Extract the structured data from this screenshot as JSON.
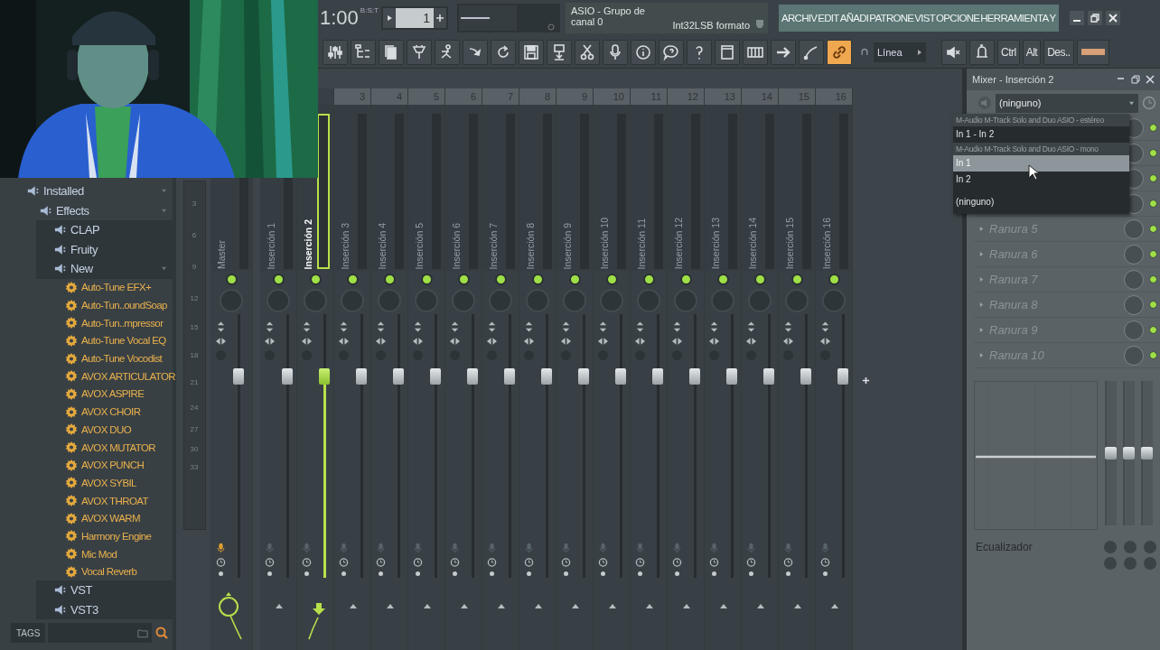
{
  "transport": {
    "time": "1:00",
    "time_unit": "B:S:T",
    "pattern": "1"
  },
  "hint": {
    "line_1": "ASIO - Grupo de",
    "line_2": "canal 0",
    "format": "Int32LSB formato"
  },
  "menu": [
    "ARCHIV",
    "EDIT",
    "AÑADI",
    "PATRONE",
    "VIST",
    "OPCIONE",
    "HERRAMIENTA",
    "Y"
  ],
  "toolbar": {
    "link_on": true,
    "snap": "Línea",
    "keys": [
      "Ctrl",
      "Alt",
      "Des.."
    ]
  },
  "browser": {
    "tree": [
      {
        "label": "Installed",
        "kind": "folder",
        "expanded": true,
        "children": [
          {
            "label": "Effects",
            "kind": "folder",
            "expanded": true,
            "children": [
              {
                "label": "CLAP",
                "kind": "folder",
                "expanded": false
              },
              {
                "label": "Fruity",
                "kind": "folder",
                "expanded": false
              },
              {
                "label": "New",
                "kind": "folder",
                "expanded": true,
                "children": [
                  {
                    "label": "Auto-Tune EFX+",
                    "kind": "plugin"
                  },
                  {
                    "label": "Auto-Tun..oundSoap",
                    "kind": "plugin"
                  },
                  {
                    "label": "Auto-Tun..mpressor",
                    "kind": "plugin"
                  },
                  {
                    "label": "Auto-Tune Vocal EQ",
                    "kind": "plugin"
                  },
                  {
                    "label": "Auto-Tune Vocodist",
                    "kind": "plugin"
                  },
                  {
                    "label": "AVOX ARTICULATOR",
                    "kind": "plugin"
                  },
                  {
                    "label": "AVOX ASPIRE",
                    "kind": "plugin"
                  },
                  {
                    "label": "AVOX CHOIR",
                    "kind": "plugin"
                  },
                  {
                    "label": "AVOX DUO",
                    "kind": "plugin"
                  },
                  {
                    "label": "AVOX MUTATOR",
                    "kind": "plugin"
                  },
                  {
                    "label": "AVOX PUNCH",
                    "kind": "plugin"
                  },
                  {
                    "label": "AVOX SYBIL",
                    "kind": "plugin"
                  },
                  {
                    "label": "AVOX THROAT",
                    "kind": "plugin"
                  },
                  {
                    "label": "AVOX WARM",
                    "kind": "plugin"
                  },
                  {
                    "label": "Harmony Engine",
                    "kind": "plugin"
                  },
                  {
                    "label": "Mic Mod",
                    "kind": "plugin"
                  },
                  {
                    "label": "Vocal Reverb",
                    "kind": "plugin"
                  }
                ]
              },
              {
                "label": "VST",
                "kind": "folder",
                "expanded": false
              },
              {
                "label": "VST3",
                "kind": "folder",
                "expanded": false
              }
            ]
          }
        ]
      }
    ],
    "tags_button": "TAGS"
  },
  "mixer": {
    "scale": [
      "3",
      "6",
      "9",
      "12",
      "15",
      "18",
      "21",
      "24",
      "27",
      "30",
      "33"
    ],
    "tracks": [
      {
        "name": "Master",
        "kind": "master",
        "selected": false,
        "on": true,
        "armed": true,
        "routed": true,
        "level": 0.78
      },
      {
        "name": "Inserción 1",
        "kind": "insert",
        "selected": false,
        "on": true,
        "armed": false,
        "routed": false,
        "level": 0.78
      },
      {
        "name": "Inserción 2",
        "kind": "insert",
        "selected": true,
        "on": true,
        "armed": false,
        "routed": true,
        "level": 0.78
      },
      {
        "name": "Inserción 3",
        "number": "3",
        "kind": "insert",
        "selected": false,
        "on": true,
        "armed": false,
        "routed": false,
        "level": 0.78
      },
      {
        "name": "Inserción 4",
        "number": "4",
        "kind": "insert",
        "selected": false,
        "on": true,
        "armed": false,
        "routed": false,
        "level": 0.78
      },
      {
        "name": "Inserción 5",
        "number": "5",
        "kind": "insert",
        "selected": false,
        "on": true,
        "armed": false,
        "routed": false,
        "level": 0.78
      },
      {
        "name": "Inserción 6",
        "number": "6",
        "kind": "insert",
        "selected": false,
        "on": true,
        "armed": false,
        "routed": false,
        "level": 0.78
      },
      {
        "name": "Inserción 7",
        "number": "7",
        "kind": "insert",
        "selected": false,
        "on": true,
        "armed": false,
        "routed": false,
        "level": 0.78
      },
      {
        "name": "Inserción 8",
        "number": "8",
        "kind": "insert",
        "selected": false,
        "on": true,
        "armed": false,
        "routed": false,
        "level": 0.78
      },
      {
        "name": "Inserción 9",
        "number": "9",
        "kind": "insert",
        "selected": false,
        "on": true,
        "armed": false,
        "routed": false,
        "level": 0.78
      },
      {
        "name": "Inserción 10",
        "number": "10",
        "kind": "insert",
        "selected": false,
        "on": true,
        "armed": false,
        "routed": false,
        "level": 0.78
      },
      {
        "name": "Inserción 11",
        "number": "11",
        "kind": "insert",
        "selected": false,
        "on": true,
        "armed": false,
        "routed": false,
        "level": 0.78
      },
      {
        "name": "Inserción 12",
        "number": "12",
        "kind": "insert",
        "selected": false,
        "on": true,
        "armed": false,
        "routed": false,
        "level": 0.78
      },
      {
        "name": "Inserción 13",
        "number": "13",
        "kind": "insert",
        "selected": false,
        "on": true,
        "armed": false,
        "routed": false,
        "level": 0.78
      },
      {
        "name": "Inserción 14",
        "number": "14",
        "kind": "insert",
        "selected": false,
        "on": true,
        "armed": false,
        "routed": false,
        "level": 0.78
      },
      {
        "name": "Inserción 15",
        "number": "15",
        "kind": "insert",
        "selected": false,
        "on": true,
        "armed": false,
        "routed": false,
        "level": 0.78
      },
      {
        "name": "Inserción 16",
        "number": "16",
        "kind": "insert",
        "selected": false,
        "on": true,
        "armed": false,
        "routed": false,
        "level": 0.78
      }
    ]
  },
  "panel": {
    "title": "Mixer - Inserción 2",
    "input": "(ninguno)",
    "input_menu": [
      {
        "label": "M-Audio M-Track Solo and Duo ASIO - estéreo",
        "kind": "header"
      },
      {
        "label": "In 1 - In 2",
        "kind": "option",
        "selected": false
      },
      {
        "label": "M-Audio M-Track Solo and Duo ASIO - mono",
        "kind": "header"
      },
      {
        "label": "In 1",
        "kind": "option",
        "selected": true
      },
      {
        "label": "In 2",
        "kind": "option",
        "selected": false
      },
      {
        "label": "(ninguno)",
        "kind": "option",
        "selected": false
      }
    ],
    "slots": [
      {
        "on": true
      },
      {
        "on": true
      },
      {
        "on": true
      },
      {
        "on": true
      },
      {
        "label": "Ranura 5",
        "on": true
      },
      {
        "label": "Ranura 6",
        "on": true
      },
      {
        "label": "Ranura 7",
        "on": true
      },
      {
        "label": "Ranura 8",
        "on": true
      },
      {
        "label": "Ranura 9",
        "on": true
      },
      {
        "label": "Ranura 10",
        "on": true
      }
    ],
    "eq_label": "Ecualizador",
    "eq_bands": [
      {
        "level": 0.5
      },
      {
        "level": 0.5
      },
      {
        "level": 0.5
      }
    ]
  }
}
